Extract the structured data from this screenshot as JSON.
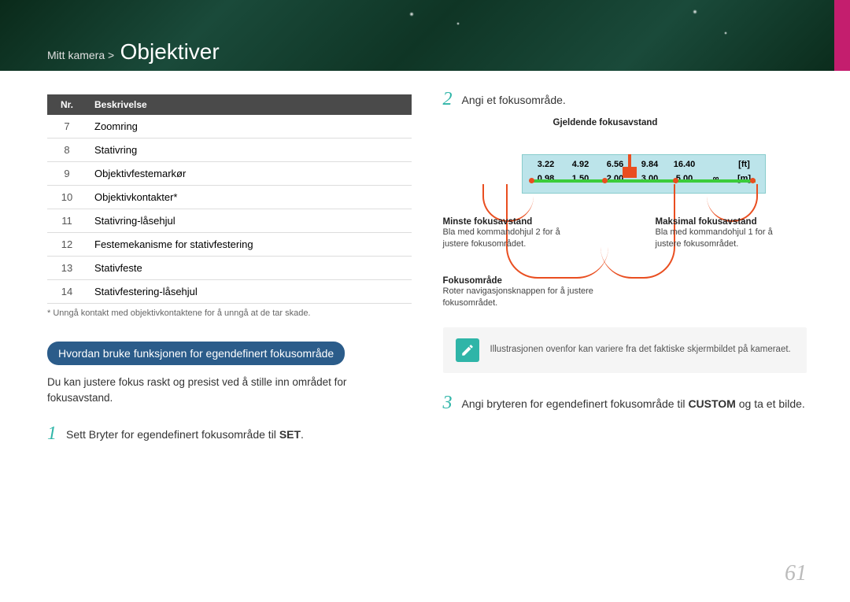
{
  "header": {
    "breadcrumb_parent": "Mitt kamera >",
    "breadcrumb_current": "Objektiver"
  },
  "table": {
    "headers": [
      "Nr.",
      "Beskrivelse"
    ],
    "rows": [
      [
        "7",
        "Zoomring"
      ],
      [
        "8",
        "Stativring"
      ],
      [
        "9",
        "Objektivfestemarkør"
      ],
      [
        "10",
        "Objektivkontakter*"
      ],
      [
        "11",
        "Stativring-låsehjul"
      ],
      [
        "12",
        "Festemekanisme for stativfestering"
      ],
      [
        "13",
        "Stativfeste"
      ],
      [
        "14",
        "Stativfestering-låsehjul"
      ]
    ],
    "footnote": "* Unngå kontakt med objektivkontaktene for å unngå at de tar skade."
  },
  "section": {
    "title": "Hvordan bruke funksjonen for egendefinert fokusområde",
    "desc": "Du kan justere fokus raskt og presist ved å stille inn området for fokusavstand."
  },
  "steps": {
    "s1": {
      "num": "1",
      "pre": "Sett Bryter for egendefinert fokusområde til ",
      "strong": "SET",
      "post": "."
    },
    "s2": {
      "num": "2",
      "text": "Angi et fokusområde."
    },
    "s3": {
      "num": "3",
      "pre": "Angi bryteren for egendefinert fokusområde til ",
      "strong": "CUSTOM",
      "post": " og ta et bilde."
    }
  },
  "diagram": {
    "current": "Gjeldende fokusavstand",
    "ft_row": [
      "3.22",
      "4.92",
      "6.56",
      "9.84",
      "16.40",
      "",
      "[ft]"
    ],
    "m_row": [
      "0.98",
      "1.50",
      "2.00",
      "3.00",
      "5.00",
      "∞",
      "[m]"
    ],
    "min": {
      "title": "Minste fokusavstand",
      "desc": "Bla med kommandohjul 2 for å justere fokusområdet."
    },
    "max": {
      "title": "Maksimal fokusavstand",
      "desc": "Bla med kommandohjul 1 for å justere fokusområdet."
    },
    "focus": {
      "title": "Fokusområde",
      "desc": "Roter navigasjonsknappen for å justere fokusområdet."
    }
  },
  "note": "Illustrasjonen ovenfor kan variere fra det faktiske skjermbildet på kameraet.",
  "page_number": "61"
}
